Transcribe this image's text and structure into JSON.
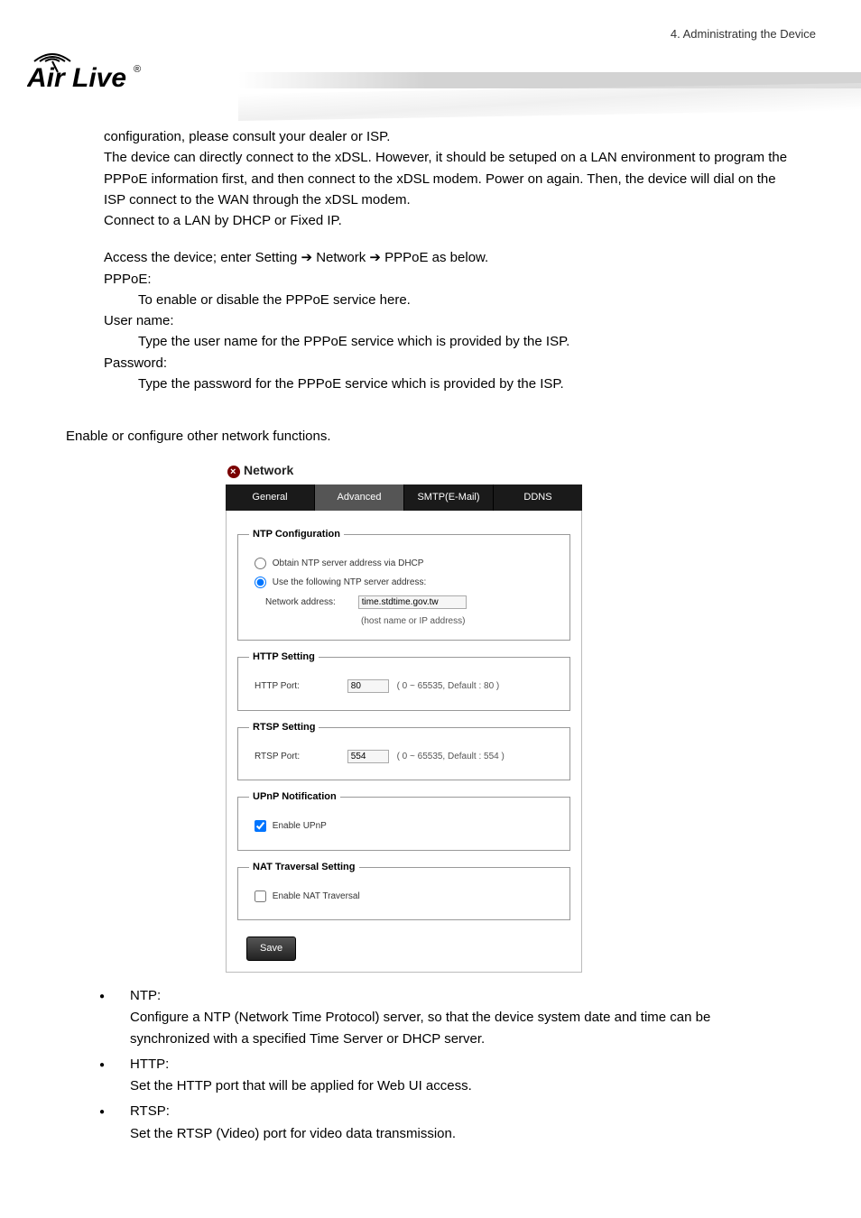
{
  "header": {
    "chapter": "4. Administrating the Device",
    "brand": "Air Live"
  },
  "body": {
    "p1": "configuration, please consult your dealer or ISP.",
    "p2": "The device can directly connect to the xDSL. However, it should be setuped on a LAN environment to program the PPPoE information first, and then connect to the xDSL modem.   Power on again.   Then, the device will dial on the ISP connect to the WAN through the xDSL modem.",
    "p3": "Connect to a LAN by DHCP or Fixed IP.",
    "access_pre": "Access the device; enter Setting ",
    "access_mid1": " Network ",
    "access_post": " PPPoE as below.",
    "pppoe_lbl": "PPPoE:",
    "pppoe_txt": "To enable or disable the PPPoE service here.",
    "user_lbl": "User name:",
    "user_txt": "Type the user name for the PPPoE service which is provided by the ISP.",
    "pass_lbl": "Password:",
    "pass_txt": "Type the password for the PPPoE service which is provided by the ISP.",
    "configure_heading": "Enable or configure other network functions."
  },
  "panel": {
    "title": "Network",
    "tabs": {
      "general": "General",
      "advanced": "Advanced",
      "smtp": "SMTP(E-Mail)",
      "ddns": "DDNS"
    },
    "ntp": {
      "legend": "NTP Configuration",
      "opt1": "Obtain NTP server address via DHCP",
      "opt2": "Use the following NTP server address:",
      "addr_label": "Network address:",
      "addr_value": "time.stdtime.gov.tw",
      "addr_hint": "(host name or IP address)"
    },
    "http": {
      "legend": "HTTP Setting",
      "port_label": "HTTP Port:",
      "port_value": "80",
      "port_hint": "( 0 ~ 65535, Default : 80 )"
    },
    "rtsp": {
      "legend": "RTSP Setting",
      "port_label": "RTSP Port:",
      "port_value": "554",
      "port_hint": "( 0 ~ 65535, Default : 554 )"
    },
    "upnp": {
      "legend": "UPnP Notification",
      "chk": "Enable UPnP"
    },
    "nat": {
      "legend": "NAT Traversal Setting",
      "chk": "Enable NAT Traversal"
    },
    "save": "Save"
  },
  "bullets": {
    "ntp_t": "NTP:",
    "ntp_b": "Configure a NTP (Network Time Protocol) server, so that the device system date and time can be synchronized with a specified Time Server or DHCP server.",
    "http_t": "HTTP:",
    "http_b": "Set the HTTP port that will be applied for Web UI access.",
    "rtsp_t": "RTSP:",
    "rtsp_b": "Set the RTSP (Video) port for video data transmission."
  },
  "chart_data": null
}
